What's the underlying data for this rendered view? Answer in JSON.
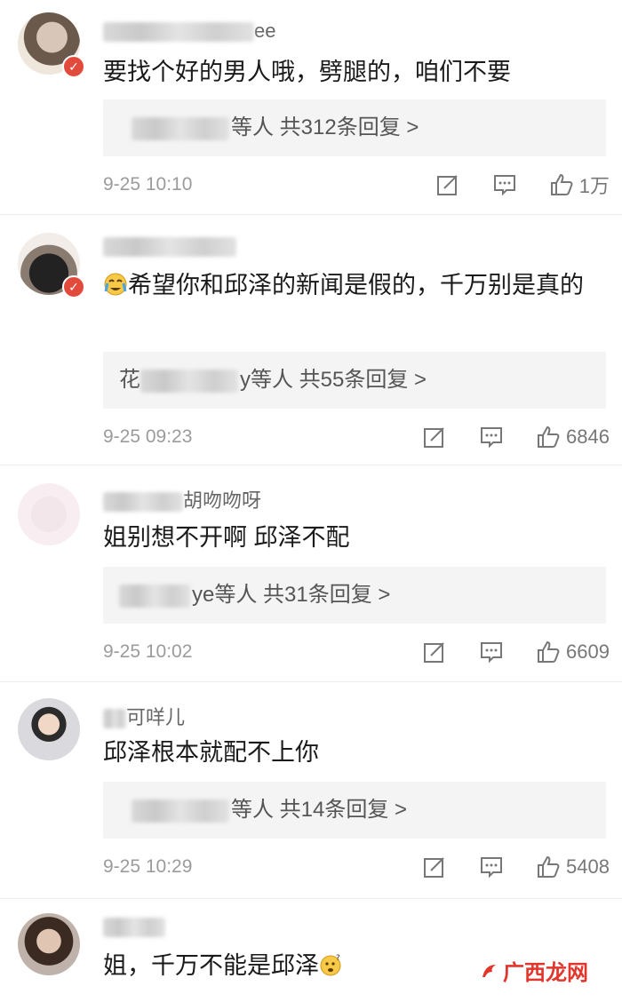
{
  "comments": [
    {
      "username_suffix": "ee",
      "text": "要找个好的男人哦，劈腿的，咱们不要",
      "reply_prefix": "",
      "reply_suffix": "等人  共312条回复 >",
      "time": "9-25 10:10",
      "likes": "1万"
    },
    {
      "username_suffix": "",
      "text": "希望你和邱泽的新闻是假的，千万别是真的",
      "reply_prefix": "花",
      "reply_suffix": "y等人  共55条回复 >",
      "time": "9-25 09:23",
      "likes": "6846"
    },
    {
      "username_suffix": "胡吻吻呀",
      "text": "姐别想不开啊 邱泽不配",
      "reply_prefix": "",
      "reply_suffix": "ye等人  共31条回复 >",
      "time": "9-25 10:02",
      "likes": "6609"
    },
    {
      "username_suffix": "可咩儿",
      "text": "邱泽根本就配不上你",
      "reply_prefix": "",
      "reply_suffix": "等人  共14条回复 >",
      "time": "9-25 10:29",
      "likes": "5408"
    },
    {
      "username_suffix": "",
      "text": "姐，千万不能是邱泽"
    }
  ],
  "watermark": {
    "text": "广西龙网"
  },
  "colors": {
    "badge": "#e24a3b",
    "reply_bg": "#f4f4f4",
    "watermark": "#e2362c"
  },
  "icons": [
    "edit-icon",
    "comment-icon",
    "like-icon",
    "crying-emoji",
    "thinking-emoji"
  ]
}
